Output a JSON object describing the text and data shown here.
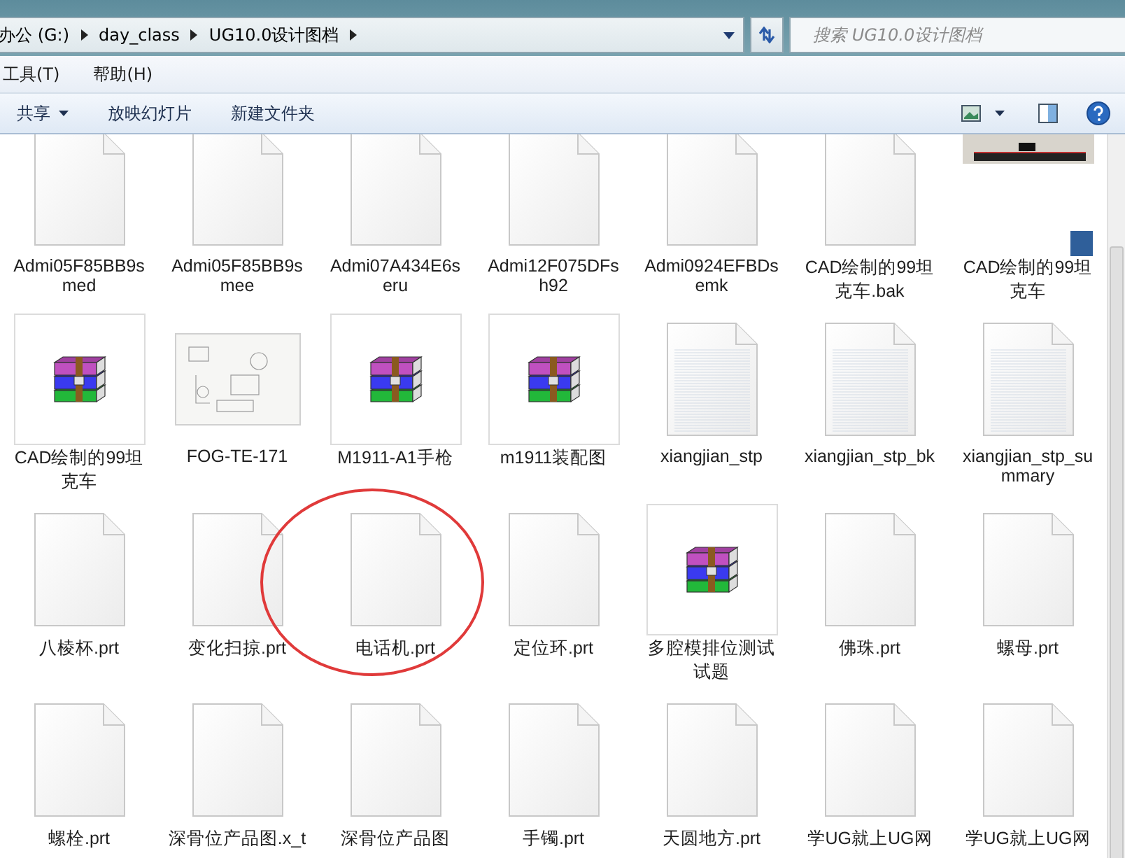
{
  "address_bar": {
    "crumbs": [
      "办公 (G:)",
      "day_class",
      "UG10.0设计图档"
    ]
  },
  "search": {
    "placeholder": "搜索 UG10.0设计图档"
  },
  "menu_bar": [
    "工具(T)",
    "帮助(H)"
  ],
  "toolbar": [
    {
      "label": "共享",
      "dropdown": true
    },
    {
      "label": "放映幻灯片",
      "dropdown": false
    },
    {
      "label": "新建文件夹",
      "dropdown": false
    }
  ],
  "files": [
    {
      "name": "Admi05F85BB9smed",
      "kind": "blank",
      "circled": false
    },
    {
      "name": "Admi05F85BB9smee",
      "kind": "blank",
      "circled": false
    },
    {
      "name": "Admi07A434E6seru",
      "kind": "blank",
      "circled": false
    },
    {
      "name": "Admi12F075DFsh92",
      "kind": "blank",
      "circled": false
    },
    {
      "name": "Admi0924EFBDsemk",
      "kind": "blank",
      "circled": false
    },
    {
      "name": "CAD绘制的99坦克车.bak",
      "kind": "blank",
      "circled": false
    },
    {
      "name": "CAD绘制的99坦克车",
      "kind": "render",
      "circled": false
    },
    {
      "name": "CAD绘制的99坦克车",
      "kind": "archive",
      "circled": false
    },
    {
      "name": "FOG-TE-171",
      "kind": "sketch",
      "circled": false
    },
    {
      "name": "M1911-A1手枪",
      "kind": "archive",
      "circled": false
    },
    {
      "name": "m1911装配图",
      "kind": "archive",
      "circled": false
    },
    {
      "name": "xiangjian_stp",
      "kind": "text",
      "circled": false
    },
    {
      "name": "xiangjian_stp_bk",
      "kind": "text",
      "circled": false
    },
    {
      "name": "xiangjian_stp_summary",
      "kind": "text",
      "circled": false
    },
    {
      "name": "八棱杯.prt",
      "kind": "blank",
      "circled": false
    },
    {
      "name": "变化扫掠.prt",
      "kind": "blank",
      "circled": false
    },
    {
      "name": "电话机.prt",
      "kind": "blank",
      "circled": true
    },
    {
      "name": "定位环.prt",
      "kind": "blank",
      "circled": false
    },
    {
      "name": "多腔模排位测试试题",
      "kind": "archive",
      "circled": false
    },
    {
      "name": "佛珠.prt",
      "kind": "blank",
      "circled": false
    },
    {
      "name": "螺母.prt",
      "kind": "blank",
      "circled": false
    },
    {
      "name": "螺栓.prt",
      "kind": "blank",
      "circled": false
    },
    {
      "name": "深骨位产品图.x_t",
      "kind": "blank",
      "circled": false
    },
    {
      "name": "深骨位产品图",
      "kind": "blank",
      "circled": false
    },
    {
      "name": "手镯.prt",
      "kind": "blank",
      "circled": false
    },
    {
      "name": "天圆地方.prt",
      "kind": "blank",
      "circled": false
    },
    {
      "name": "学UG就上UG网",
      "kind": "blank",
      "circled": false
    },
    {
      "name": "学UG就上UG网",
      "kind": "blank",
      "circled": false
    }
  ]
}
